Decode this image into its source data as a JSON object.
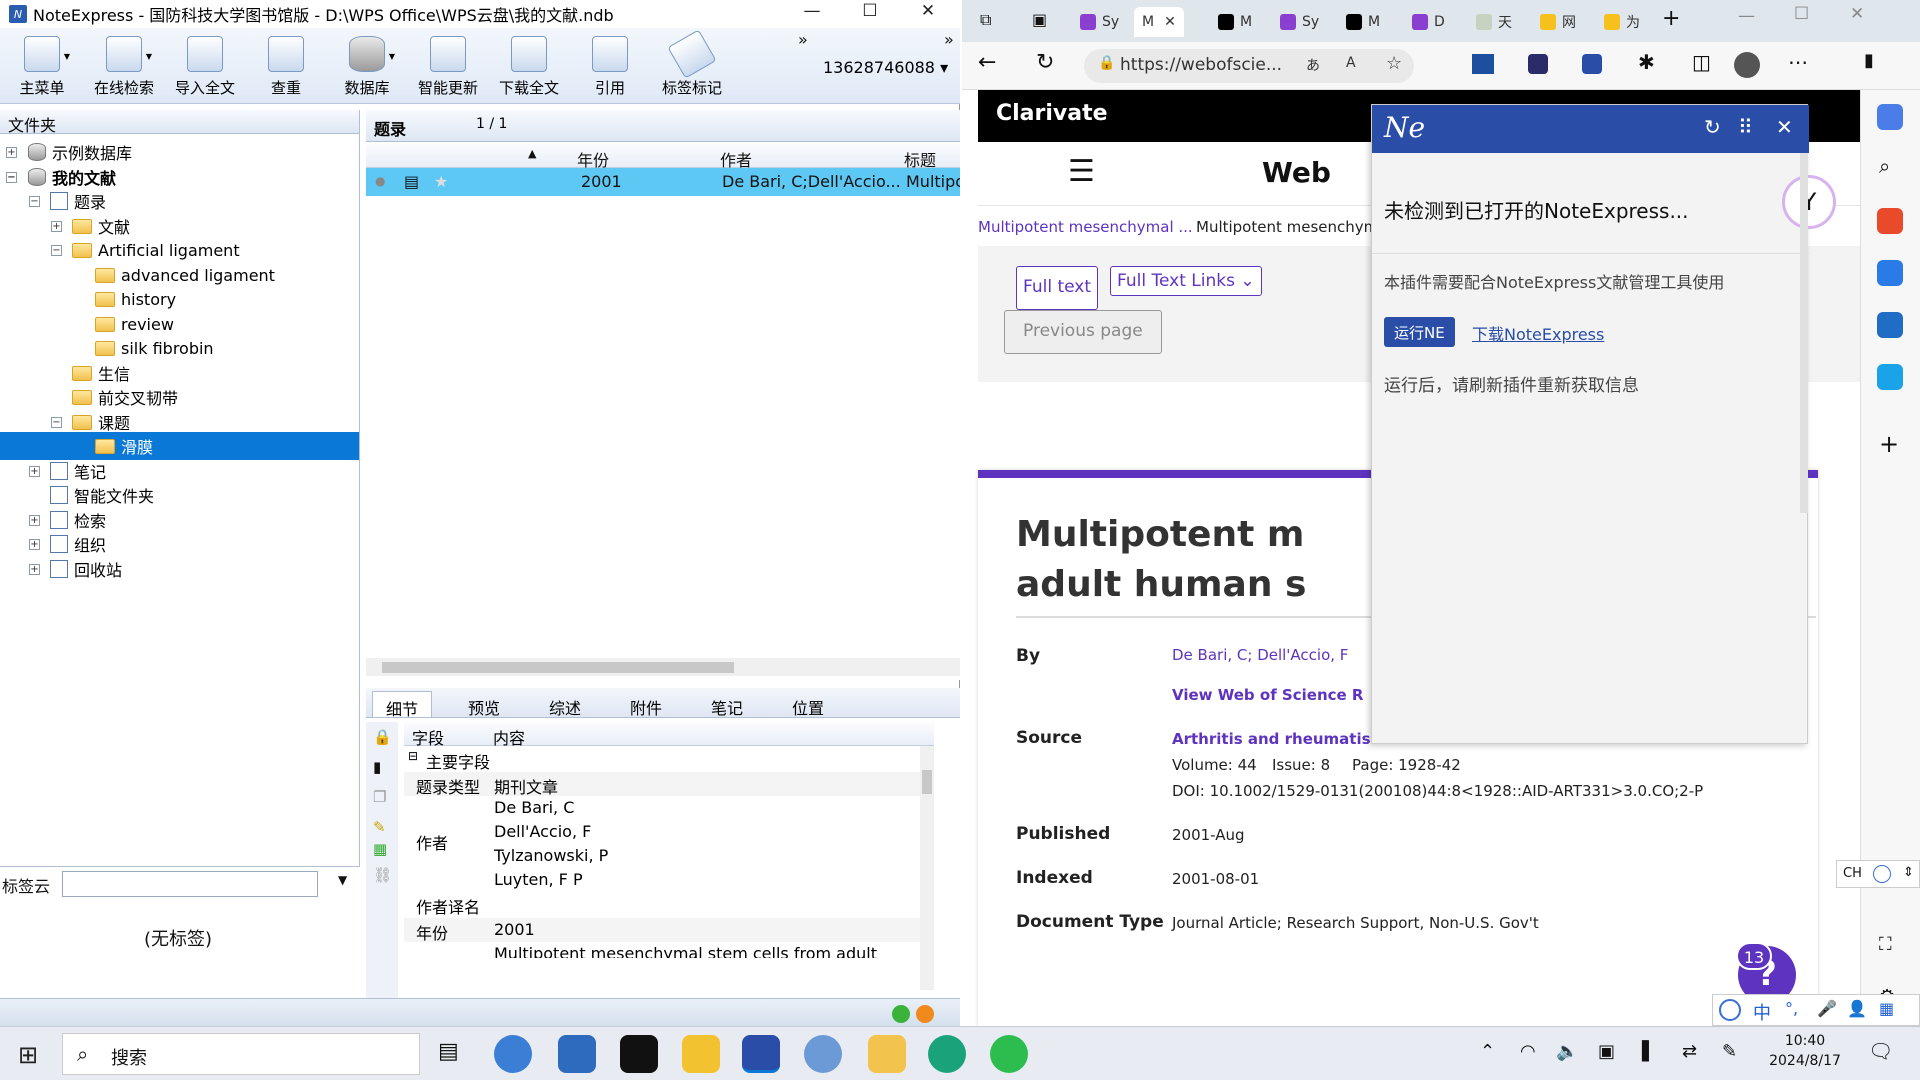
{
  "noteexpress": {
    "title": "NoteExpress - 国防科技大学图书馆版 - D:\\WPS Office\\WPS云盘\\我的文献.ndb",
    "toolbar": [
      {
        "label": "主菜单",
        "icon": "main-menu-icon"
      },
      {
        "label": "在线检索",
        "icon": "online-search-icon"
      },
      {
        "label": "导入全文",
        "icon": "import-fulltext-icon"
      },
      {
        "label": "查重",
        "icon": "dedupe-icon"
      },
      {
        "label": "数据库",
        "icon": "database-icon"
      },
      {
        "label": "智能更新",
        "icon": "smart-update-icon"
      },
      {
        "label": "下载全文",
        "icon": "download-fulltext-icon"
      },
      {
        "label": "引用",
        "icon": "cite-icon"
      },
      {
        "label": "标签标记",
        "icon": "tag-icon"
      }
    ],
    "account": "13628746088",
    "folders_header": "文件夹",
    "tree": [
      {
        "label": "示例数据库"
      },
      {
        "label": "我的文献"
      },
      {
        "label": "题录"
      },
      {
        "label": "文献"
      },
      {
        "label": "Artificial ligament"
      },
      {
        "label": "advanced ligament"
      },
      {
        "label": "history"
      },
      {
        "label": "review"
      },
      {
        "label": "silk fibrobin"
      },
      {
        "label": "生信"
      },
      {
        "label": "前交叉韧带"
      },
      {
        "label": "课题"
      },
      {
        "label": "滑膜"
      },
      {
        "label": "笔记"
      },
      {
        "label": "智能文件夹"
      },
      {
        "label": "检索"
      },
      {
        "label": "组织"
      },
      {
        "label": "回收站"
      }
    ],
    "tag_cloud_label": "标签云",
    "no_tags": "(无标签)",
    "records_header": "题录",
    "page_info": "1 / 1",
    "columns": {
      "year": "年份",
      "author": "作者",
      "title": "标题"
    },
    "record": {
      "year": "2001",
      "author": "De Bari, C;Dell'Accio...",
      "title": "Multipo"
    },
    "detail_tabs": [
      "细节",
      "预览",
      "综述",
      "附件",
      "笔记",
      "位置"
    ],
    "detail_cols": {
      "field": "字段",
      "content": "内容"
    },
    "detail_group": "主要字段",
    "detail_rows": {
      "type_label": "题录类型",
      "type_value": "期刊文章",
      "author_label": "作者",
      "authors": [
        "De Bari, C",
        "Dell'Accio, F",
        "Tylzanowski, P",
        "Luyten, F P"
      ],
      "translated_label": "作者译名",
      "year_label": "年份",
      "year_value": "2001",
      "title_partial": "Multipotent mesenchymal stem cells from adult"
    }
  },
  "browser": {
    "tabs": [
      "Sy",
      "M",
      "M",
      "Sy",
      "M",
      "D",
      "天",
      "网",
      "为"
    ],
    "url": "https://webofscie...",
    "site_brand": "Clarivate",
    "site_name": "Web",
    "breadcrumb1": "Multipotent mesenchymal ...",
    "breadcrumb2": "Multipotent mesenchym",
    "full_text": "Full text",
    "full_text_links": "Full Text Links",
    "previous_page": "Previous page",
    "article_title_l1": "Multipotent mesenc",
    "article_title_l2": "adult human synovi",
    "by_label": "By",
    "authors": "De Bari, C; Dell'Accio, F",
    "view_wos": "View Web of Science R",
    "source_label": "Source",
    "journal": "Arthritis and rheumatism",
    "volume": "Volume: 44",
    "issue": "Issue: 8",
    "page": "Page: 1928-42",
    "doi": "DOI: 10.1002/1529-0131(200108)44:8<1928::AID-ART331>3.0.CO;2-P",
    "published_label": "Published",
    "published_value": "2001-Aug",
    "indexed_label": "Indexed",
    "indexed_value": "2001-08-01",
    "doctype_label": "Document Type",
    "doctype_value": "Journal Article; Research Support, Non-U.S. Gov't",
    "help_badge": "13"
  },
  "extension": {
    "logo": "Ne",
    "heading": "未检测到已打开的NoteExpress...",
    "desc": "本插件需要配合NoteExpress文献管理工具使用",
    "run_button": "运行NE",
    "download_link": "下载NoteExpress",
    "hint": "运行后，请刷新插件重新获取信息"
  },
  "ime": {
    "lang": "CH",
    "mode": "中"
  },
  "taskbar": {
    "search_placeholder": "搜索",
    "time": "10:40",
    "date": "2024/8/17"
  },
  "colors": {
    "accent": "#5e33bf",
    "ne_blue": "#2a4da8",
    "selection": "#0a78d7",
    "row_highlight": "#5ec8f5"
  }
}
